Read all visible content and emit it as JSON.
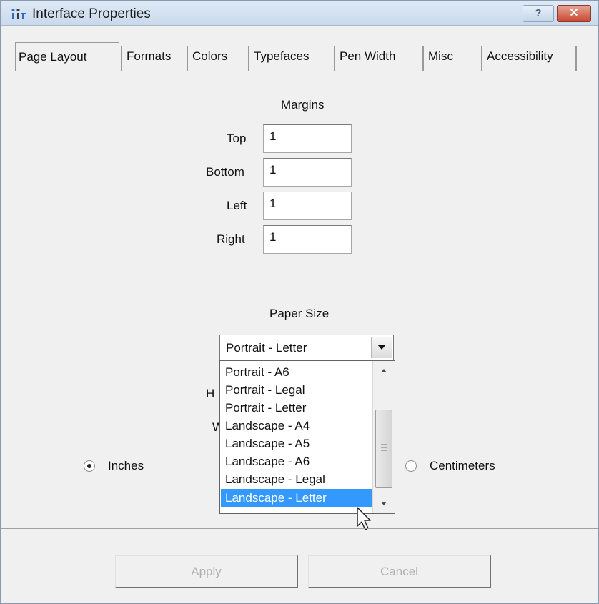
{
  "window": {
    "title": "Interface Properties",
    "app_icon": "interface-properties-icon",
    "help_label": "?",
    "close_label": "✕"
  },
  "tabs": [
    {
      "label": "Page Layout",
      "active": true
    },
    {
      "label": "Formats"
    },
    {
      "label": "Colors"
    },
    {
      "label": "Typefaces"
    },
    {
      "label": "Pen Width"
    },
    {
      "label": "Misc"
    },
    {
      "label": "Accessibility"
    }
  ],
  "margins": {
    "heading": "Margins",
    "top_label": "Top",
    "top_value": "1",
    "bottom_label": "Bottom",
    "bottom_value": "1",
    "left_label": "Left",
    "left_value": "1",
    "right_label": "Right",
    "right_value": "1"
  },
  "paper": {
    "heading": "Paper Size",
    "selected": "Portrait - Letter",
    "options": [
      "Portrait - A6",
      "Portrait - Legal",
      "Portrait - Letter",
      "Landscape - A4",
      "Landscape - A5",
      "Landscape - A6",
      "Landscape - Legal",
      "Landscape - Letter"
    ],
    "highlighted": "Landscape - Letter",
    "hidden_label_h": "H",
    "hidden_label_w": "W"
  },
  "units": {
    "inches_label": "Inches",
    "inches_checked": true,
    "cm_label": "Centimeters"
  },
  "buttons": {
    "apply": "Apply",
    "cancel": "Cancel"
  },
  "colors": {
    "selection": "#3399ff",
    "close_button": "#c9472e"
  }
}
